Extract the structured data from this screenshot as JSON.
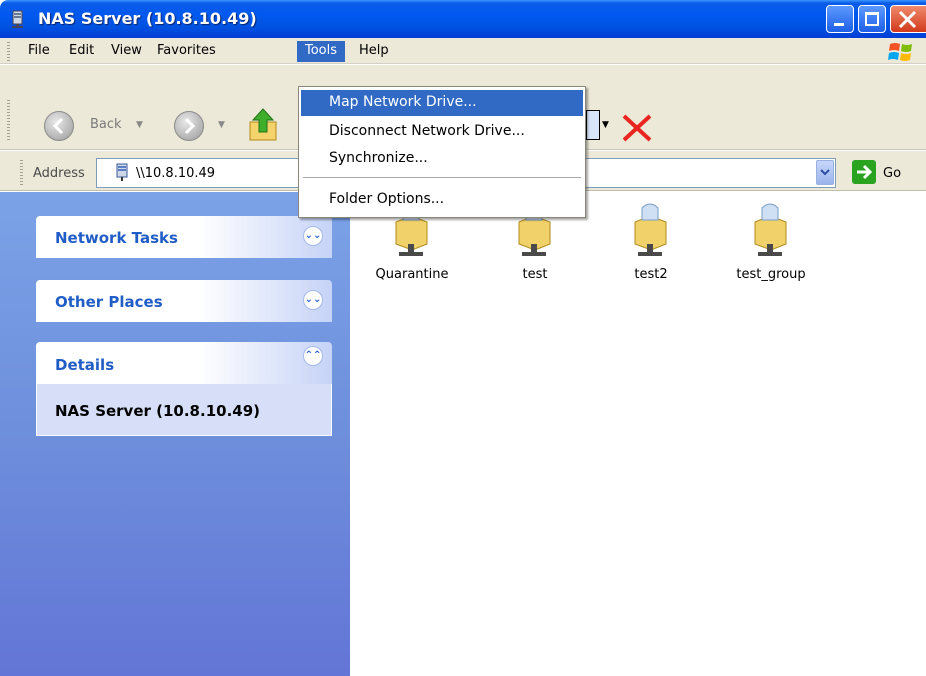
{
  "window": {
    "title": "NAS Server (10.8.10.49)"
  },
  "menubar": {
    "items": [
      "File",
      "Edit",
      "View",
      "Favorites",
      "Tools",
      "Help"
    ],
    "active": "Tools"
  },
  "toolbar": {
    "back_label": "Back"
  },
  "address": {
    "label": "Address",
    "value": "\\\\10.8.10.49",
    "go_label": "Go"
  },
  "tools_menu": {
    "items": [
      {
        "label": "Map Network Drive..."
      },
      {
        "label": "Disconnect Network Drive..."
      },
      {
        "label": "Synchronize..."
      },
      {
        "label": "Folder Options..."
      }
    ],
    "highlighted": "Map Network Drive..."
  },
  "left_pane": {
    "panels": [
      {
        "title": "Network Tasks",
        "expanded": false
      },
      {
        "title": "Other Places",
        "expanded": false
      },
      {
        "title": "Details",
        "expanded": true
      }
    ],
    "details_text": "NAS Server (10.8.10.49)"
  },
  "folders": [
    {
      "name": "Quarantine",
      "icon": "shared-folder-icon"
    },
    {
      "name": "test",
      "icon": "shared-folder-icon"
    },
    {
      "name": "test2",
      "icon": "shared-folder-icon"
    },
    {
      "name": "test_group",
      "icon": "shared-folder-icon"
    }
  ],
  "colors": {
    "titlebar_blue": "#0058ee",
    "menu_highlight": "#316ac5",
    "taskpane_header_text": "#215dc6",
    "chrome_bg": "#ece9d8"
  }
}
